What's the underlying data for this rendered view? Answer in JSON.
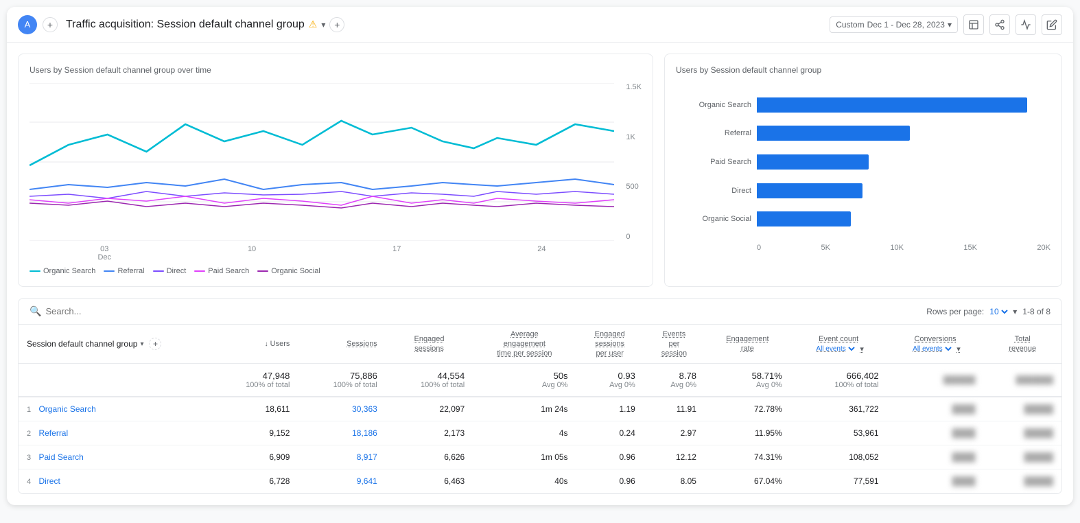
{
  "header": {
    "avatar_label": "A",
    "title": "Traffic acquisition: Session default channel group",
    "warning_icon": "⚠",
    "date_label": "Custom",
    "date_range": "Dec 1 - Dec 28, 2023",
    "add_icon": "+",
    "add2_icon": "+"
  },
  "line_chart": {
    "title": "Users by Session default channel group over time",
    "y_labels": [
      "1.5K",
      "1K",
      "500",
      "0"
    ],
    "x_labels": [
      "03\nDec",
      "10",
      "17",
      "24"
    ],
    "legend": [
      {
        "label": "Organic Search",
        "color": "#00bcd4"
      },
      {
        "label": "Referral",
        "color": "#4285f4"
      },
      {
        "label": "Direct",
        "color": "#7c4dff"
      },
      {
        "label": "Paid Search",
        "color": "#e040fb"
      },
      {
        "label": "Organic Social",
        "color": "#9c27b0"
      }
    ]
  },
  "bar_chart": {
    "title": "Users by Session default channel group",
    "bars": [
      {
        "label": "Organic Search",
        "value": 18611,
        "max": 20000,
        "width_pct": 92
      },
      {
        "label": "Referral",
        "value": 9152,
        "max": 20000,
        "width_pct": 52
      },
      {
        "label": "Paid Search",
        "value": 6909,
        "max": 20000,
        "width_pct": 38
      },
      {
        "label": "Direct",
        "value": 6728,
        "max": 20000,
        "width_pct": 37
      },
      {
        "label": "Organic Social",
        "value": 5800,
        "max": 20000,
        "width_pct": 32
      }
    ],
    "x_labels": [
      "0",
      "5K",
      "10K",
      "15K",
      "20K"
    ]
  },
  "table": {
    "search_placeholder": "Search...",
    "rows_per_page_label": "Rows per page:",
    "rows_per_page_value": "10",
    "pagination_label": "1-8 of 8",
    "dim_column": "Session default channel group",
    "columns": [
      {
        "label": "↓ Users",
        "key": "users"
      },
      {
        "label": "Sessions",
        "key": "sessions",
        "underline": true
      },
      {
        "label": "Engaged sessions",
        "key": "engaged_sessions",
        "underline": true
      },
      {
        "label": "Average engagement time per session",
        "key": "avg_time",
        "underline": true
      },
      {
        "label": "Engaged sessions per user",
        "key": "engaged_per_user",
        "underline": true
      },
      {
        "label": "Events per session",
        "key": "events_per_session",
        "underline": true
      },
      {
        "label": "Engagement rate",
        "key": "eng_rate",
        "underline": true
      },
      {
        "label": "Event count",
        "key": "event_count",
        "underline": true,
        "has_select": true,
        "select_label": "All events"
      },
      {
        "label": "Conversions",
        "key": "conversions",
        "underline": true,
        "has_select": true,
        "select_label": "All events"
      },
      {
        "label": "Total revenue",
        "key": "revenue",
        "underline": true
      }
    ],
    "totals": {
      "users": "47,948",
      "users_pct": "100% of total",
      "sessions": "75,886",
      "sessions_pct": "100% of total",
      "engaged": "44,554",
      "engaged_pct": "100% of total",
      "avg_time": "50s",
      "avg_time_pct": "Avg 0%",
      "engaged_per_user": "0.93",
      "engaged_per_user_pct": "Avg 0%",
      "events_per_session": "8.78",
      "events_per_session_pct": "Avg 0%",
      "eng_rate": "58.71%",
      "eng_rate_pct": "Avg 0%",
      "event_count": "666,402",
      "event_count_pct": "100% of total"
    },
    "rows": [
      {
        "num": "1",
        "channel": "Organic Search",
        "users": "18,611",
        "sessions": "30,363",
        "engaged": "22,097",
        "avg_time": "1m 24s",
        "eng_per_user": "1.19",
        "events_per_session": "11.91",
        "eng_rate": "72.78%",
        "event_count": "361,722"
      },
      {
        "num": "2",
        "channel": "Referral",
        "users": "9,152",
        "sessions": "18,186",
        "engaged": "2,173",
        "avg_time": "4s",
        "eng_per_user": "0.24",
        "events_per_session": "2.97",
        "eng_rate": "11.95%",
        "event_count": "53,961"
      },
      {
        "num": "3",
        "channel": "Paid Search",
        "users": "6,909",
        "sessions": "8,917",
        "engaged": "6,626",
        "avg_time": "1m 05s",
        "eng_per_user": "0.96",
        "events_per_session": "12.12",
        "eng_rate": "74.31%",
        "event_count": "108,052"
      },
      {
        "num": "4",
        "channel": "Direct",
        "users": "6,728",
        "sessions": "9,641",
        "engaged": "6,463",
        "avg_time": "40s",
        "eng_per_user": "0.96",
        "events_per_session": "8.05",
        "eng_rate": "67.04%",
        "event_count": "77,591"
      }
    ]
  }
}
